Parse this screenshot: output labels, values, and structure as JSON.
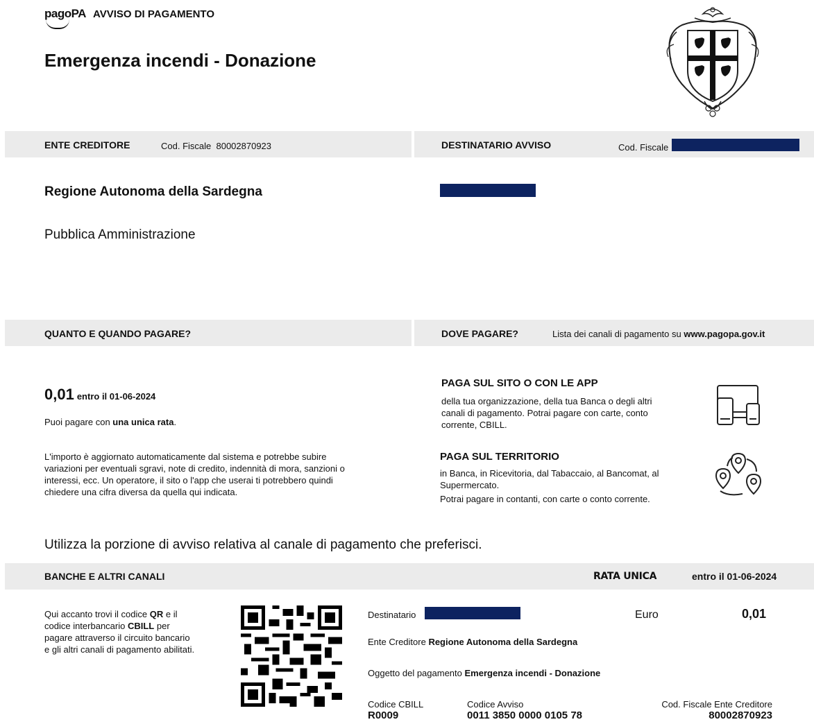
{
  "header": {
    "logo_text": "pagoPA",
    "notice_type": "AVVISO DI PAGAMENTO",
    "title": "Emergenza incendi - Donazione"
  },
  "creditor_section": {
    "heading": "ENTE CREDITORE",
    "tax_code_label": "Cod. Fiscale",
    "tax_code": "80002870923",
    "name": "Regione Autonoma della Sardegna",
    "type": "Pubblica Amministrazione"
  },
  "recipient_section": {
    "heading": "DESTINATARIO AVVISO",
    "tax_code_label": "Cod. Fiscale"
  },
  "amount_section": {
    "heading": "QUANTO E QUANDO PAGARE?",
    "amount": "0,01",
    "due_text": "entro il 01-06-2024",
    "installment_prefix": "Puoi pagare con ",
    "installment_bold": "una unica rata",
    "installment_suffix": ".",
    "info": "L'importo è aggiornato automaticamente dal sistema e potrebbe subire variazioni per eventuali sgravi, note di credito, indennità di mora, sanzioni o interessi, ecc. Un operatore, il sito o l'app che userai ti potrebbero quindi chiedere una cifra diversa da quella qui indicata."
  },
  "where_section": {
    "heading": "DOVE PAGARE?",
    "channels_text": "Lista dei canali di pagamento su ",
    "channels_link": "www.pagopa.gov.it",
    "online_title": "PAGA SUL SITO O CON LE APP",
    "online_desc": "della tua organizzazione, della tua Banca o degli altri canali di pagamento. Potrai pagare con carte, conto corrente, CBILL.",
    "territory_title": "PAGA SUL TERRITORIO",
    "territory_desc_1": "in Banca, in Ricevitoria, dal Tabaccaio, al Bancomat, al Supermercato.",
    "territory_desc_2": "Potrai pagare in contanti, con carte o conto corrente.",
    "online_icon": "devices-icon",
    "territory_icon": "map-pins-icon"
  },
  "portion_note": "Utilizza la porzione di avviso relativa al canale di pagamento che preferisci.",
  "bank_section": {
    "heading": "BANCHE E ALTRI CANALI",
    "installment_label": "RATA UNICA",
    "due_text": "entro il 01-06-2024",
    "qr_desc_1": "Qui accanto trovi il codice ",
    "qr_desc_qr": "QR",
    "qr_desc_2": " e il codice interbancario ",
    "qr_desc_cbill": "CBILL",
    "qr_desc_3": " per pagare attraverso il circuito bancario e gli altri canali di pagamento abilitati.",
    "recipient_label": "Destinatario",
    "currency_label": "Euro",
    "amount": "0,01",
    "creditor_label": "Ente Creditore ",
    "creditor_name": "Regione Autonoma della Sardegna",
    "subject_label": "Oggetto del pagamento ",
    "subject": "Emergenza incendi - Donazione",
    "cbill_label": "Codice CBILL",
    "cbill": "R0009",
    "notice_code_label": "Codice Avviso",
    "notice_code": "0011 3850 0000 0105 78",
    "creditor_tax_label": "Cod. Fiscale Ente Creditore",
    "creditor_tax": "80002870923"
  },
  "colors": {
    "bar_bg": "#ebebeb",
    "redaction": "#0d2360"
  }
}
